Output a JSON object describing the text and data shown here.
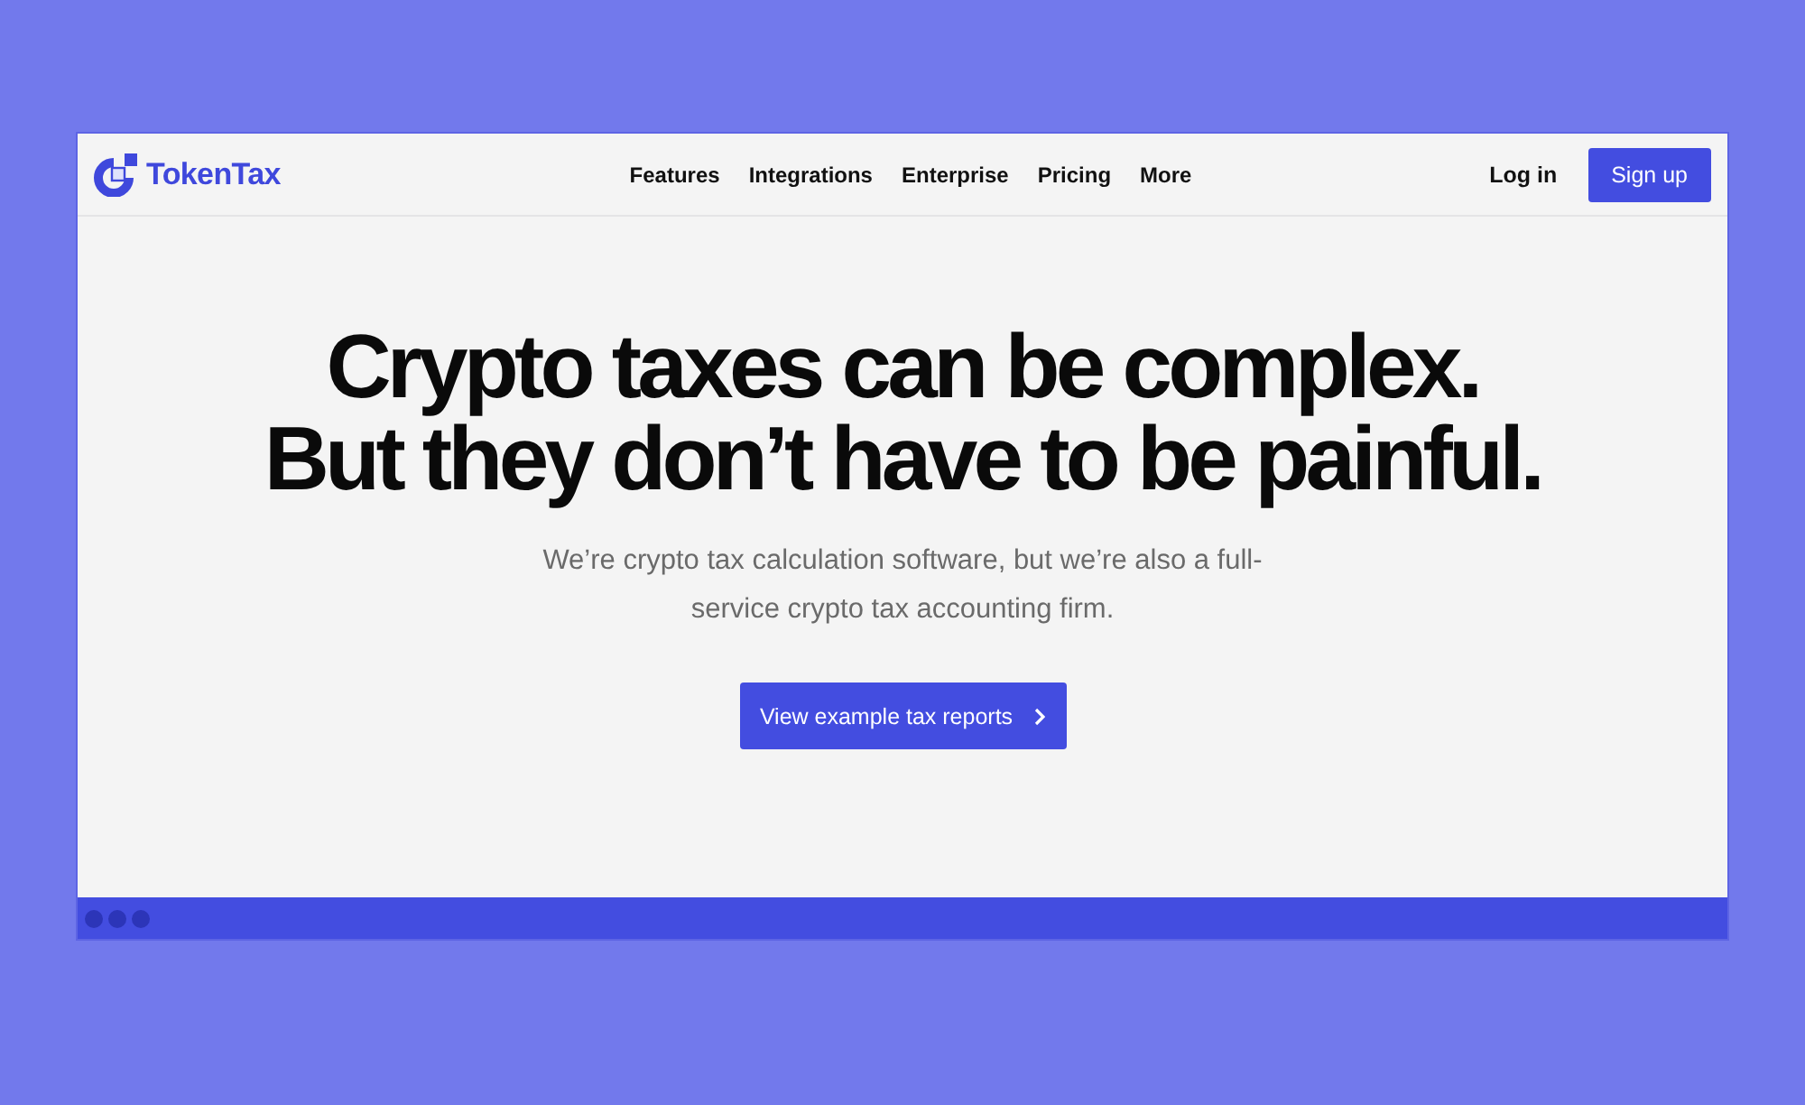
{
  "header": {
    "logo": {
      "text": "TokenTax"
    },
    "nav_links": [
      {
        "label": "Features"
      },
      {
        "label": "Integrations"
      },
      {
        "label": "Enterprise"
      },
      {
        "label": "Pricing"
      },
      {
        "label": "More"
      }
    ],
    "login": "Log in",
    "signup": "Sign up"
  },
  "hero": {
    "headline": "Crypto taxes can be complex. But they don’t have to be painful.",
    "subtitle": "We’re crypto tax calculation software, but we’re also a full-service crypto tax accounting firm.",
    "cta": "View example tax reports"
  }
}
